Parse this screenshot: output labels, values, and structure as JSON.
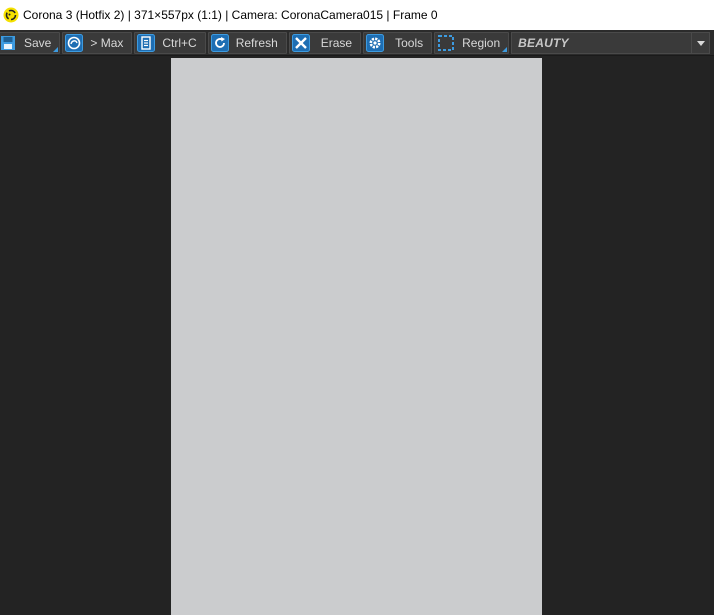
{
  "window": {
    "title": "Corona 3 (Hotfix 2) | 371×557px (1:1) | Camera: CoronaCamera015 | Frame 0",
    "icon": "corona-logo-icon"
  },
  "toolbar": {
    "buttons": [
      {
        "label": "Save",
        "icon": "save-icon",
        "has_dropdown": true
      },
      {
        "label": "> Max",
        "icon": "max-icon",
        "has_dropdown": false
      },
      {
        "label": "Ctrl+C",
        "icon": "copy-icon",
        "has_dropdown": false
      },
      {
        "label": "Refresh",
        "icon": "refresh-icon",
        "has_dropdown": false
      },
      {
        "label": "Erase",
        "icon": "erase-icon",
        "has_dropdown": false
      },
      {
        "label": "Tools",
        "icon": "gear-icon",
        "has_dropdown": false
      },
      {
        "label": "Region",
        "icon": "region-icon",
        "has_dropdown": true
      }
    ],
    "render_pass": {
      "selected": "BEAUTY"
    }
  },
  "colors": {
    "accent": "#3d9be0",
    "canvas": "#cbccce",
    "background": "#232323",
    "toolbar": "#2b2b2b"
  }
}
